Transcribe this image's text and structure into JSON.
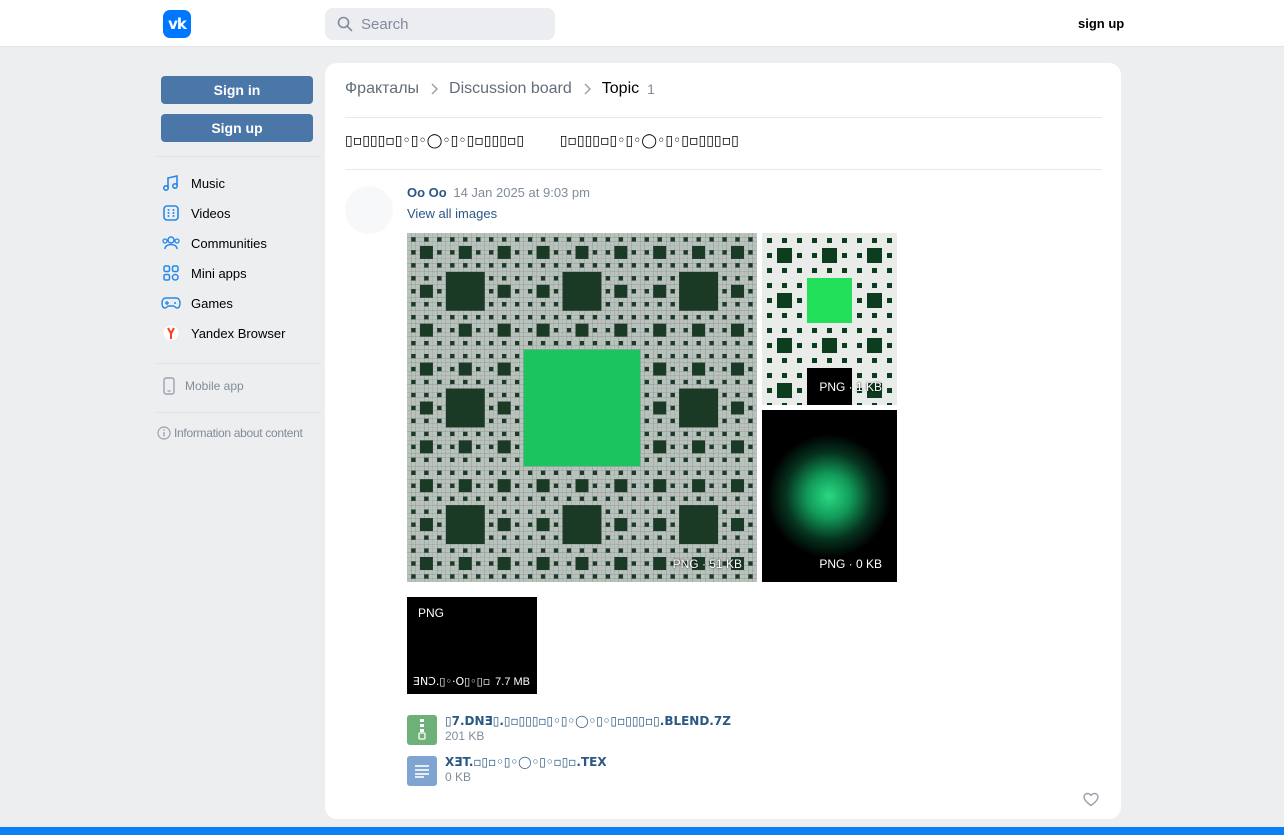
{
  "header": {
    "logo_text": "vk",
    "search_placeholder": "Search",
    "signup_link": "sign up"
  },
  "sidebar": {
    "signin_label": "Sign in",
    "signup_label": "Sign up",
    "items": [
      {
        "label": "Music",
        "icon": "music-icon"
      },
      {
        "label": "Videos",
        "icon": "videos-icon"
      },
      {
        "label": "Communities",
        "icon": "communities-icon"
      },
      {
        "label": "Mini apps",
        "icon": "mini-apps-icon"
      },
      {
        "label": "Games",
        "icon": "games-icon"
      },
      {
        "label": "Yandex Browser",
        "icon": "yandex-icon"
      }
    ],
    "mobile_app": "Mobile app",
    "info": "Information about content"
  },
  "breadcrumb": {
    "group": "Фракталы",
    "board": "Discussion board",
    "current": "Topic",
    "count": "1"
  },
  "topic": {
    "title": "▯▫▯▯▯▫▯◦▯◦◯◦▯◦▯▫▯▯▯▫▯        ▯▫▯▯▯▫▯◦▯◦◯◦▯◦▯▫▯▯▯▫▯"
  },
  "post": {
    "author": "Oo Oo",
    "date": "14 Jan 2025 at 9:03 pm",
    "view_all": "View all images",
    "images": [
      {
        "label": "PNG · 51 KB"
      },
      {
        "label": "PNG · 1 KB"
      },
      {
        "label": "PNG · 0 KB"
      }
    ],
    "doc": {
      "ext": "PNG",
      "name": "ƎNƆ.▯◦·O▯◦▯▫▯",
      "name_suffix": "...",
      "size": "7.7 MB"
    },
    "files": [
      {
        "name": "▯7.DNƎ▯.▯▫▯▯▯▫▯◦▯◦◯◦▯◦▯▫▯▯▯▫▯.BLEND.7Z",
        "size": "201 KB",
        "icon": "archive-icon",
        "color": "#6db078"
      },
      {
        "name": "XƎT.▫▯▫◦▯◦◯◦▯◦▫▯▫.TEX",
        "size": "0 KB",
        "icon": "text-file-icon",
        "color": "#7fa4d1"
      }
    ]
  },
  "colors": {
    "accent": "#4a76a8",
    "link": "#2a5885",
    "fractal_green": "#1ed760",
    "bottom_bar": "#0d7ff5"
  }
}
